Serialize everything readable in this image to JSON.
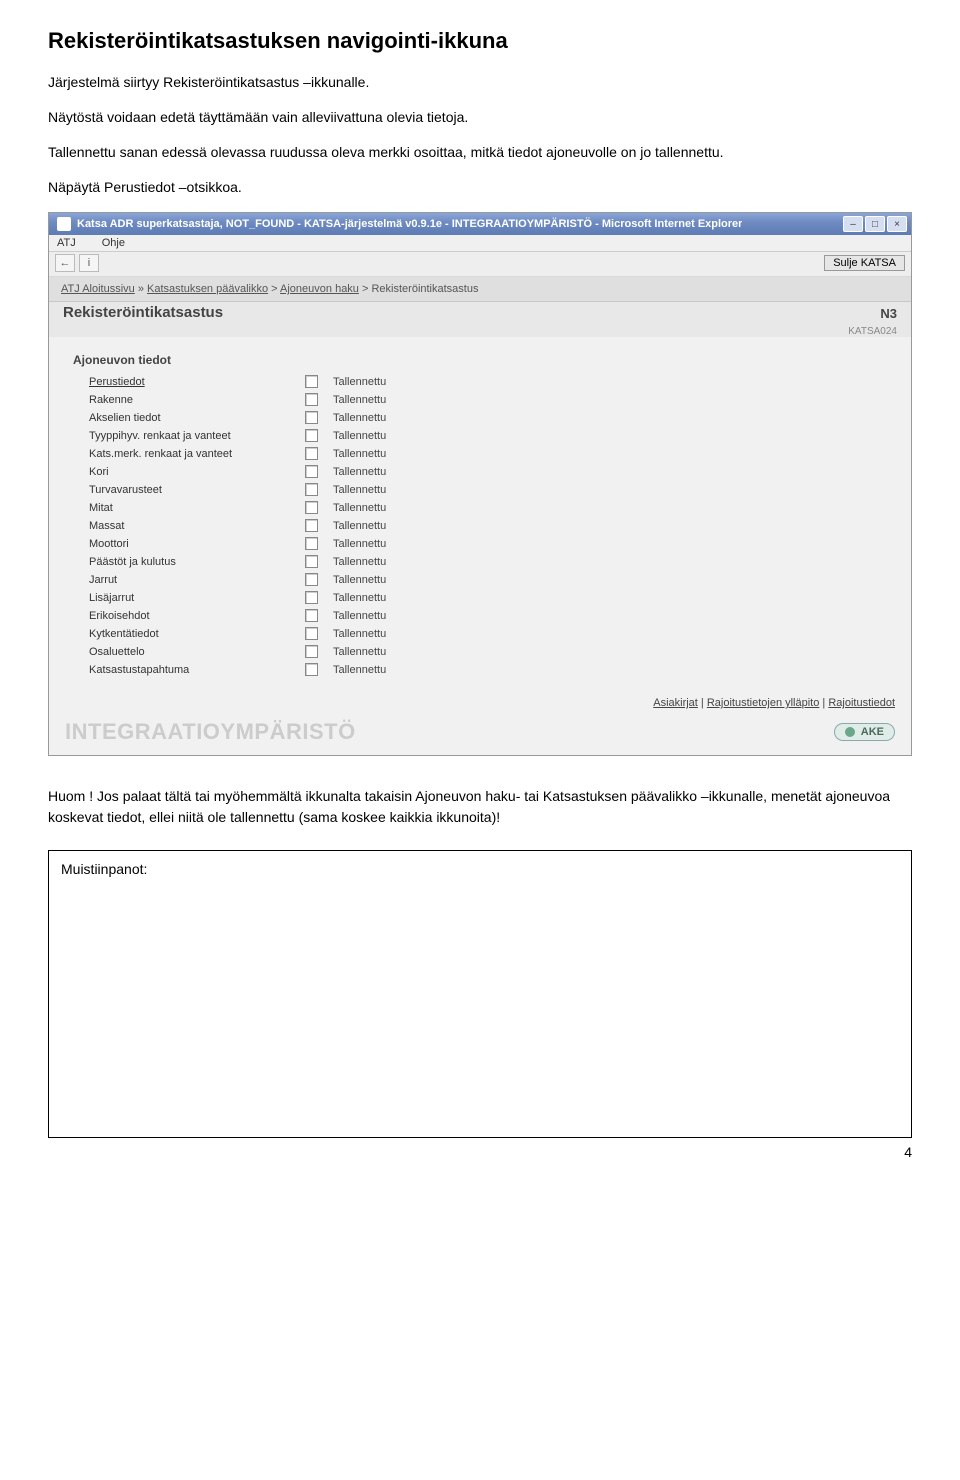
{
  "doc": {
    "title": "Rekisteröintikatsastuksen navigointi-ikkuna",
    "para1": "Järjestelmä siirtyy Rekisteröintikatsastus –ikkunalle.",
    "para2": "Näytöstä voidaan edetä täyttämään vain alleviivattuna olevia tietoja.",
    "para3": "Tallennettu sanan edessä olevassa ruudussa oleva merkki osoittaa, mitkä tiedot ajoneuvolle on jo tallennettu.",
    "para4": "Näpäytä Perustiedot –otsikkoa.",
    "after": "Huom ! Jos palaat tältä tai myöhemmältä ikkunalta takaisin Ajoneuvon haku- tai Katsastuksen päävalikko –ikkunalle, menetät ajoneuvoa koskevat tiedot, ellei niitä ole tallennettu (sama koskee kaikkia ikkunoita)!",
    "notes_label": "Muistiinpanot:",
    "page": "4"
  },
  "app": {
    "window_title": "Katsa ADR superkatsastaja, NOT_FOUND - KATSA-järjestelmä v0.9.1e - INTEGRAATIOYMPÄRISTÖ - Microsoft Internet Explorer",
    "menu": {
      "atj": "ATJ",
      "ohje": "Ohje"
    },
    "close_label": "Sulje KATSA",
    "breadcrumb": {
      "a": "ATJ Aloitussivu",
      "b": "Katsastuksen päävalikko",
      "c": "Ajoneuvon haku",
      "d": "Rekisteröintikatsastus",
      "sep": " > ",
      "first_sep": " » "
    },
    "vehicle_class": "N3",
    "page_title": "Rekisteröintikatsastus",
    "page_code": "KATSA024",
    "section_heading": "Ajoneuvon tiedot",
    "status_word": "Tallennettu",
    "rows": [
      "Perustiedot",
      "Rakenne",
      "Akselien tiedot",
      "Tyyppihyv. renkaat ja vanteet",
      "Kats.merk. renkaat ja vanteet",
      "Kori",
      "Turvavarusteet",
      "Mitat",
      "Massat",
      "Moottori",
      "Päästöt ja kulutus",
      "Jarrut",
      "Lisäjarrut",
      "Erikoisehdot",
      "Kytkentätiedot",
      "Osaluettelo",
      "Katsastustapahtuma"
    ],
    "bottom_links": {
      "a": "Asiakirjat",
      "b": "Rajoitustietojen ylläpito",
      "c": "Rajoitustiedot",
      "sep": " | "
    },
    "watermark": "INTEGRAATIOYMPÄRISTÖ",
    "ake": "AKE"
  }
}
